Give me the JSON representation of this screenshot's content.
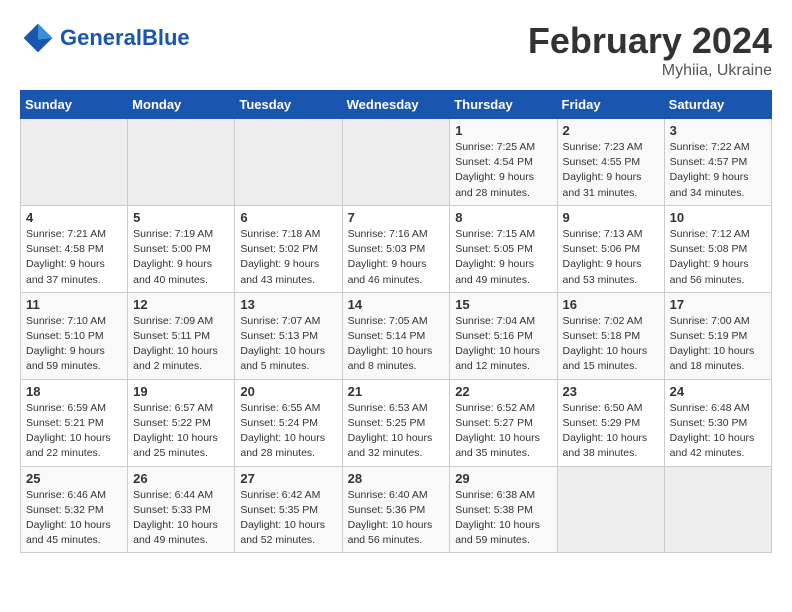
{
  "header": {
    "logo_general": "General",
    "logo_blue": "Blue",
    "title": "February 2024",
    "subtitle": "Myhiia, Ukraine"
  },
  "calendar": {
    "days_of_week": [
      "Sunday",
      "Monday",
      "Tuesday",
      "Wednesday",
      "Thursday",
      "Friday",
      "Saturday"
    ],
    "weeks": [
      [
        {
          "day": "",
          "detail": ""
        },
        {
          "day": "",
          "detail": ""
        },
        {
          "day": "",
          "detail": ""
        },
        {
          "day": "",
          "detail": ""
        },
        {
          "day": "1",
          "detail": "Sunrise: 7:25 AM\nSunset: 4:54 PM\nDaylight: 9 hours\nand 28 minutes."
        },
        {
          "day": "2",
          "detail": "Sunrise: 7:23 AM\nSunset: 4:55 PM\nDaylight: 9 hours\nand 31 minutes."
        },
        {
          "day": "3",
          "detail": "Sunrise: 7:22 AM\nSunset: 4:57 PM\nDaylight: 9 hours\nand 34 minutes."
        }
      ],
      [
        {
          "day": "4",
          "detail": "Sunrise: 7:21 AM\nSunset: 4:58 PM\nDaylight: 9 hours\nand 37 minutes."
        },
        {
          "day": "5",
          "detail": "Sunrise: 7:19 AM\nSunset: 5:00 PM\nDaylight: 9 hours\nand 40 minutes."
        },
        {
          "day": "6",
          "detail": "Sunrise: 7:18 AM\nSunset: 5:02 PM\nDaylight: 9 hours\nand 43 minutes."
        },
        {
          "day": "7",
          "detail": "Sunrise: 7:16 AM\nSunset: 5:03 PM\nDaylight: 9 hours\nand 46 minutes."
        },
        {
          "day": "8",
          "detail": "Sunrise: 7:15 AM\nSunset: 5:05 PM\nDaylight: 9 hours\nand 49 minutes."
        },
        {
          "day": "9",
          "detail": "Sunrise: 7:13 AM\nSunset: 5:06 PM\nDaylight: 9 hours\nand 53 minutes."
        },
        {
          "day": "10",
          "detail": "Sunrise: 7:12 AM\nSunset: 5:08 PM\nDaylight: 9 hours\nand 56 minutes."
        }
      ],
      [
        {
          "day": "11",
          "detail": "Sunrise: 7:10 AM\nSunset: 5:10 PM\nDaylight: 9 hours\nand 59 minutes."
        },
        {
          "day": "12",
          "detail": "Sunrise: 7:09 AM\nSunset: 5:11 PM\nDaylight: 10 hours\nand 2 minutes."
        },
        {
          "day": "13",
          "detail": "Sunrise: 7:07 AM\nSunset: 5:13 PM\nDaylight: 10 hours\nand 5 minutes."
        },
        {
          "day": "14",
          "detail": "Sunrise: 7:05 AM\nSunset: 5:14 PM\nDaylight: 10 hours\nand 8 minutes."
        },
        {
          "day": "15",
          "detail": "Sunrise: 7:04 AM\nSunset: 5:16 PM\nDaylight: 10 hours\nand 12 minutes."
        },
        {
          "day": "16",
          "detail": "Sunrise: 7:02 AM\nSunset: 5:18 PM\nDaylight: 10 hours\nand 15 minutes."
        },
        {
          "day": "17",
          "detail": "Sunrise: 7:00 AM\nSunset: 5:19 PM\nDaylight: 10 hours\nand 18 minutes."
        }
      ],
      [
        {
          "day": "18",
          "detail": "Sunrise: 6:59 AM\nSunset: 5:21 PM\nDaylight: 10 hours\nand 22 minutes."
        },
        {
          "day": "19",
          "detail": "Sunrise: 6:57 AM\nSunset: 5:22 PM\nDaylight: 10 hours\nand 25 minutes."
        },
        {
          "day": "20",
          "detail": "Sunrise: 6:55 AM\nSunset: 5:24 PM\nDaylight: 10 hours\nand 28 minutes."
        },
        {
          "day": "21",
          "detail": "Sunrise: 6:53 AM\nSunset: 5:25 PM\nDaylight: 10 hours\nand 32 minutes."
        },
        {
          "day": "22",
          "detail": "Sunrise: 6:52 AM\nSunset: 5:27 PM\nDaylight: 10 hours\nand 35 minutes."
        },
        {
          "day": "23",
          "detail": "Sunrise: 6:50 AM\nSunset: 5:29 PM\nDaylight: 10 hours\nand 38 minutes."
        },
        {
          "day": "24",
          "detail": "Sunrise: 6:48 AM\nSunset: 5:30 PM\nDaylight: 10 hours\nand 42 minutes."
        }
      ],
      [
        {
          "day": "25",
          "detail": "Sunrise: 6:46 AM\nSunset: 5:32 PM\nDaylight: 10 hours\nand 45 minutes."
        },
        {
          "day": "26",
          "detail": "Sunrise: 6:44 AM\nSunset: 5:33 PM\nDaylight: 10 hours\nand 49 minutes."
        },
        {
          "day": "27",
          "detail": "Sunrise: 6:42 AM\nSunset: 5:35 PM\nDaylight: 10 hours\nand 52 minutes."
        },
        {
          "day": "28",
          "detail": "Sunrise: 6:40 AM\nSunset: 5:36 PM\nDaylight: 10 hours\nand 56 minutes."
        },
        {
          "day": "29",
          "detail": "Sunrise: 6:38 AM\nSunset: 5:38 PM\nDaylight: 10 hours\nand 59 minutes."
        },
        {
          "day": "",
          "detail": ""
        },
        {
          "day": "",
          "detail": ""
        }
      ]
    ]
  }
}
